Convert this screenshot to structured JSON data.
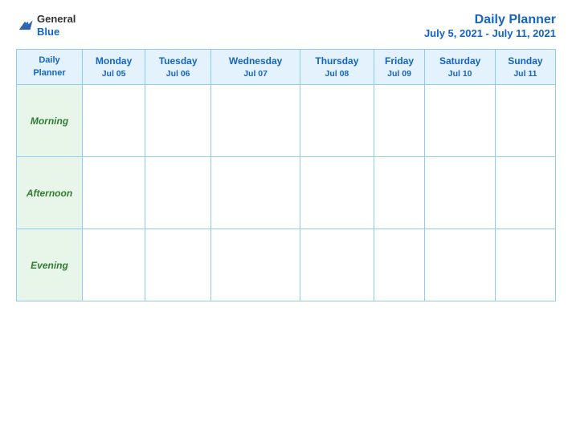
{
  "header": {
    "logo_general": "General",
    "logo_blue": "Blue",
    "title": "Daily Planner",
    "date_range": "July 5, 2021 - July 11, 2021"
  },
  "table": {
    "first_header_line1": "Daily",
    "first_header_line2": "Planner",
    "columns": [
      {
        "day": "Monday",
        "date": "Jul 05"
      },
      {
        "day": "Tuesday",
        "date": "Jul 06"
      },
      {
        "day": "Wednesday",
        "date": "Jul 07"
      },
      {
        "day": "Thursday",
        "date": "Jul 08"
      },
      {
        "day": "Friday",
        "date": "Jul 09"
      },
      {
        "day": "Saturday",
        "date": "Jul 10"
      },
      {
        "day": "Sunday",
        "date": "Jul 11"
      }
    ],
    "rows": [
      {
        "label": "Morning"
      },
      {
        "label": "Afternoon"
      },
      {
        "label": "Evening"
      }
    ]
  }
}
